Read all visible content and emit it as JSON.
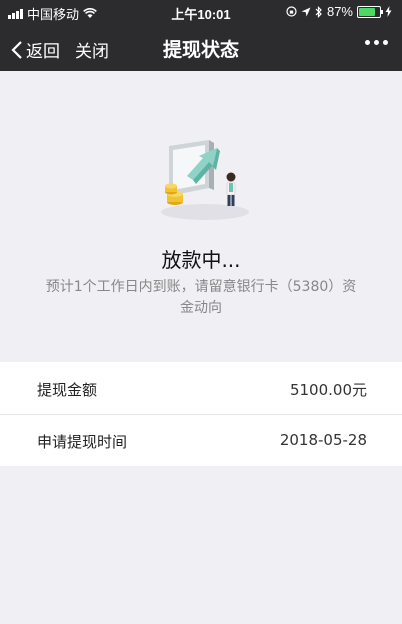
{
  "status_bar": {
    "carrier": "中国移动",
    "time": "上午10:01",
    "battery_text": "87%",
    "battery_level": 0.87,
    "wifi_icon": "wifi-icon",
    "location_icon": "location-icon",
    "bluetooth_icon": "bluetooth-icon",
    "charging_icon": "charging-icon"
  },
  "navbar": {
    "back_label": "返回",
    "close_label": "关闭",
    "title": "提现状态",
    "more_icon": "more-icon"
  },
  "status": {
    "title": "放款中...",
    "description": "预计1个工作日内到账，请留意银行卡（5380）资金动向"
  },
  "details": {
    "rows": [
      {
        "label": "提现金额",
        "value": "5100.00元"
      },
      {
        "label": "申请提现时间",
        "value": "2018-05-28"
      }
    ]
  },
  "colors": {
    "nav_background": "#2c2c2e",
    "page_background": "#efeff4",
    "battery_green": "#4cd964"
  }
}
